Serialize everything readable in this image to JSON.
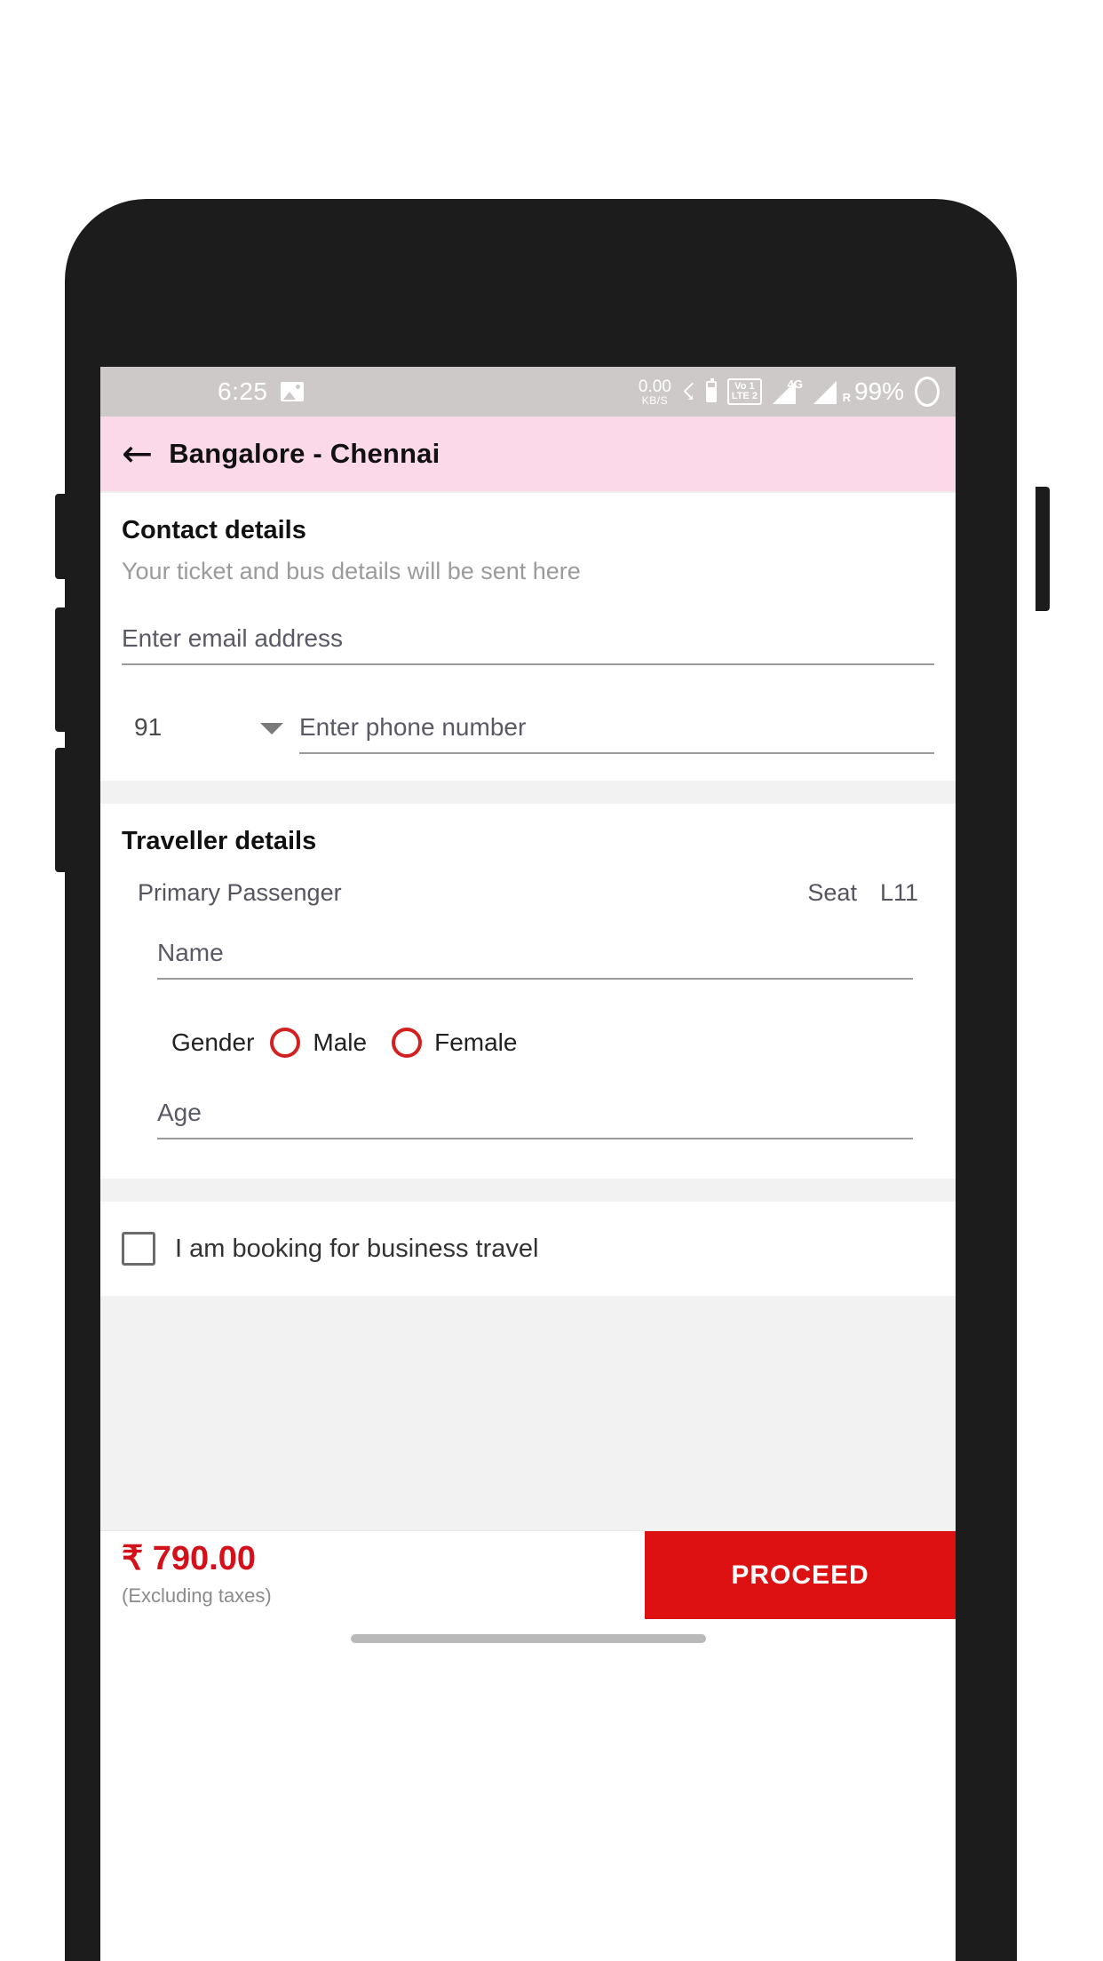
{
  "status_bar": {
    "time": "6:25",
    "image_icon": "image-icon",
    "data_rate_value": "0.00",
    "data_rate_unit": "KB/S",
    "bluetooth_icon": "bluetooth-icon",
    "bt_battery_icon": "bluetooth-battery-icon",
    "volte_top": "Vo  1",
    "volte_bottom": "LTE 2",
    "signal_1_label": "4G",
    "signal_2_label": "R",
    "battery_percent": "99%",
    "battery_icon": "battery-ring-icon"
  },
  "app_bar": {
    "back_icon": "back-arrow-icon",
    "title": "Bangalore - Chennai",
    "background_color": "#fbd9e8"
  },
  "contact": {
    "title": "Contact details",
    "subtitle": "Your ticket and bus details will be sent here",
    "email_placeholder": "Enter email address",
    "email_value": "",
    "country_code": "91",
    "phone_placeholder": "Enter phone number",
    "phone_value": ""
  },
  "traveller": {
    "title": "Traveller details",
    "passenger_label": "Primary Passenger",
    "seat_label": "Seat",
    "seat_number": "L11",
    "name_placeholder": "Name",
    "name_value": "",
    "gender_label": "Gender",
    "gender_options": [
      "Male",
      "Female"
    ],
    "gender_selected": "",
    "age_placeholder": "Age",
    "age_value": ""
  },
  "business": {
    "label": "I am booking for business travel",
    "checked": false
  },
  "bottom_bar": {
    "price": "₹ 790.00",
    "price_note": "(Excluding taxes)",
    "proceed_label": "PROCEED",
    "accent_color": "#dd1111"
  }
}
